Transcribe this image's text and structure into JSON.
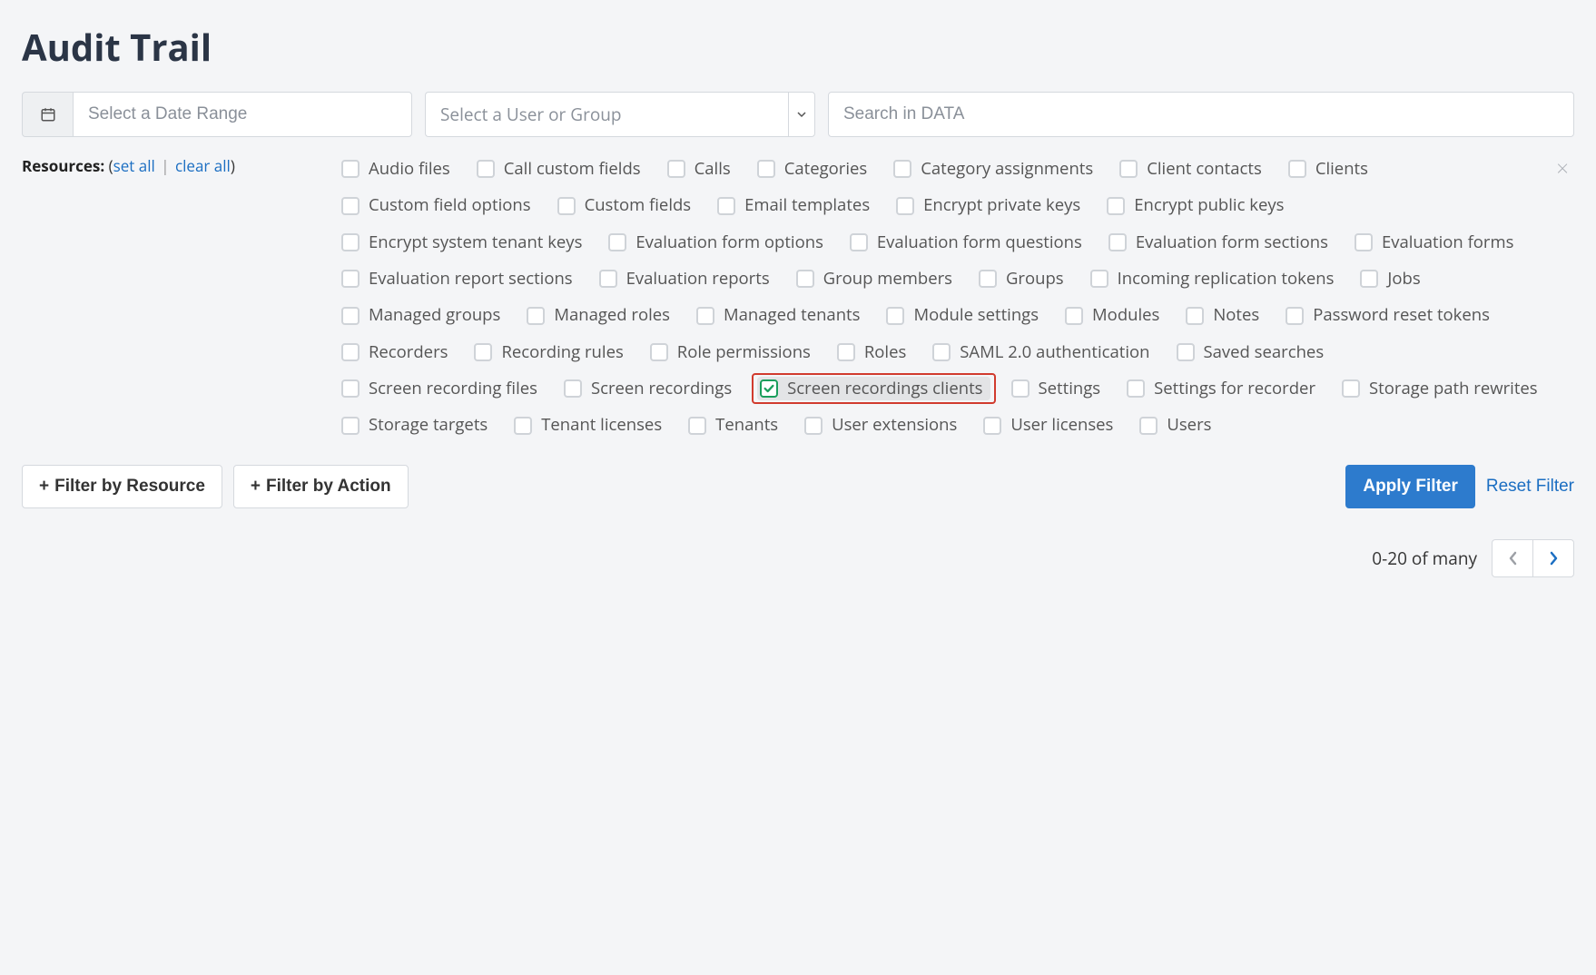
{
  "page_title": "Audit Trail",
  "date_range": {
    "placeholder": "Select a Date Range"
  },
  "user_group": {
    "placeholder": "Select a User or Group"
  },
  "search": {
    "placeholder": "Search in DATA"
  },
  "resources": {
    "label": "Resources:",
    "set_all": "set all",
    "clear_all": "clear all",
    "items": [
      {
        "label": "Audio files",
        "checked": false
      },
      {
        "label": "Call custom fields",
        "checked": false
      },
      {
        "label": "Calls",
        "checked": false
      },
      {
        "label": "Categories",
        "checked": false
      },
      {
        "label": "Category assignments",
        "checked": false
      },
      {
        "label": "Client contacts",
        "checked": false
      },
      {
        "label": "Clients",
        "checked": false
      },
      {
        "label": "Custom field options",
        "checked": false
      },
      {
        "label": "Custom fields",
        "checked": false
      },
      {
        "label": "Email templates",
        "checked": false
      },
      {
        "label": "Encrypt private keys",
        "checked": false
      },
      {
        "label": "Encrypt public keys",
        "checked": false
      },
      {
        "label": "Encrypt system tenant keys",
        "checked": false
      },
      {
        "label": "Evaluation form options",
        "checked": false
      },
      {
        "label": "Evaluation form questions",
        "checked": false
      },
      {
        "label": "Evaluation form sections",
        "checked": false
      },
      {
        "label": "Evaluation forms",
        "checked": false
      },
      {
        "label": "Evaluation report sections",
        "checked": false
      },
      {
        "label": "Evaluation reports",
        "checked": false
      },
      {
        "label": "Group members",
        "checked": false
      },
      {
        "label": "Groups",
        "checked": false
      },
      {
        "label": "Incoming replication tokens",
        "checked": false
      },
      {
        "label": "Jobs",
        "checked": false
      },
      {
        "label": "Managed groups",
        "checked": false
      },
      {
        "label": "Managed roles",
        "checked": false
      },
      {
        "label": "Managed tenants",
        "checked": false
      },
      {
        "label": "Module settings",
        "checked": false
      },
      {
        "label": "Modules",
        "checked": false
      },
      {
        "label": "Notes",
        "checked": false
      },
      {
        "label": "Password reset tokens",
        "checked": false
      },
      {
        "label": "Recorders",
        "checked": false
      },
      {
        "label": "Recording rules",
        "checked": false
      },
      {
        "label": "Role permissions",
        "checked": false
      },
      {
        "label": "Roles",
        "checked": false
      },
      {
        "label": "SAML 2.0 authentication",
        "checked": false
      },
      {
        "label": "Saved searches",
        "checked": false
      },
      {
        "label": "Screen recording files",
        "checked": false
      },
      {
        "label": "Screen recordings",
        "checked": false
      },
      {
        "label": "Screen recordings clients",
        "checked": true,
        "highlighted": true
      },
      {
        "label": "Settings",
        "checked": false
      },
      {
        "label": "Settings for recorder",
        "checked": false
      },
      {
        "label": "Storage path rewrites",
        "checked": false
      },
      {
        "label": "Storage targets",
        "checked": false
      },
      {
        "label": "Tenant licenses",
        "checked": false
      },
      {
        "label": "Tenants",
        "checked": false
      },
      {
        "label": "User extensions",
        "checked": false
      },
      {
        "label": "User licenses",
        "checked": false
      },
      {
        "label": "Users",
        "checked": false
      }
    ]
  },
  "buttons": {
    "filter_by_resource": "Filter by Resource",
    "filter_by_action": "Filter by Action",
    "apply_filter": "Apply Filter",
    "reset_filter": "Reset Filter"
  },
  "pagination": {
    "status": "0-20 of many"
  }
}
